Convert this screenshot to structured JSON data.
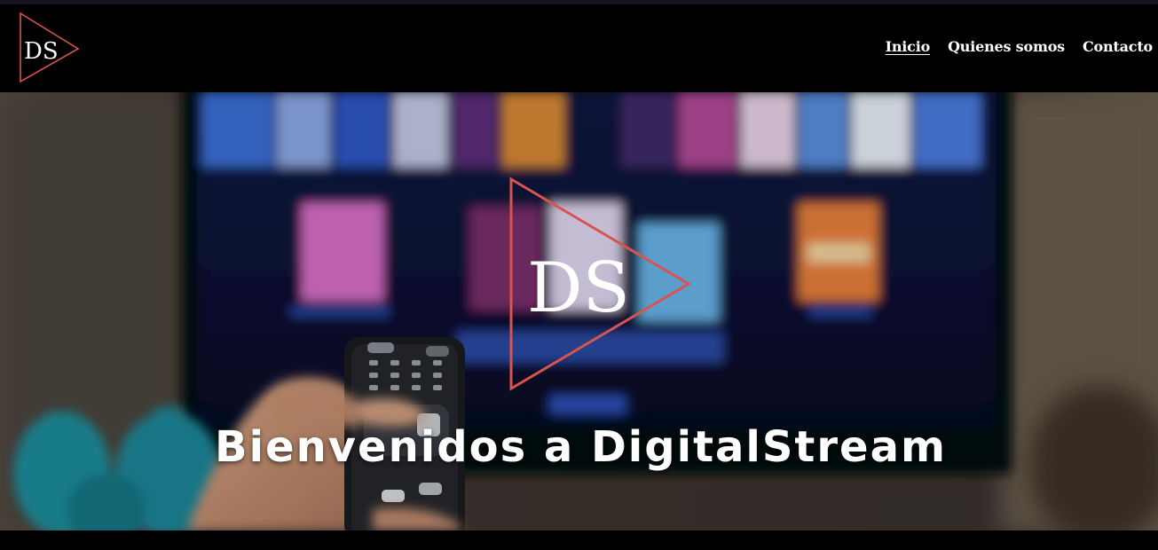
{
  "brand": {
    "logo_text": "DS",
    "accent_color": "#d9534f"
  },
  "nav": {
    "items": [
      {
        "label": "Inicio",
        "active": true
      },
      {
        "label": "Quienes somos",
        "active": false
      },
      {
        "label": "Contacto",
        "active": false
      }
    ]
  },
  "hero": {
    "logo_text": "DS",
    "title": "Bienvenidos a DigitalStream",
    "background": "blurred-tv-streaming-menu-with-remote-control"
  }
}
